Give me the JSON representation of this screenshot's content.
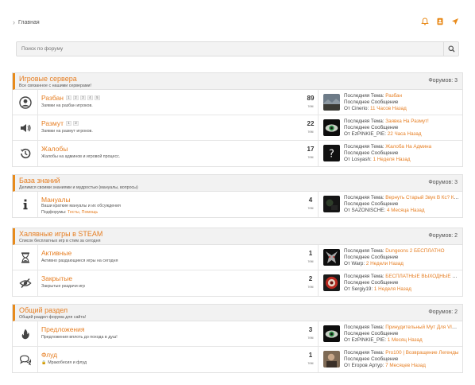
{
  "breadcrumb": {
    "home": "Главная"
  },
  "search": {
    "placeholder": "Поиск по форуму"
  },
  "sections": [
    {
      "title": "Игровые сервера",
      "desc": "Все связанное с нашими серверами!",
      "count": "Форумов: 3",
      "forums": [
        {
          "icon": "user-icon",
          "name": "Разбан",
          "pages": [
            "1",
            "2",
            "3",
            "4",
            "5"
          ],
          "desc": "Заявки на разбан игроков.",
          "sub": "",
          "sub_links": "",
          "threads": "89",
          "threads_label": "тем",
          "last_topic_label": "Последняя Тема:",
          "last_topic": "Разбан",
          "last_msg": "Последнее Сообщение",
          "from_label": "От",
          "author": "Cinerio:",
          "time": "11 Часов Назад",
          "avatar": "landscape"
        },
        {
          "icon": "volume-icon",
          "name": "Размут",
          "pages": [
            "1",
            "2"
          ],
          "desc": "Заявки на размут игроков.",
          "sub": "",
          "sub_links": "",
          "threads": "22",
          "threads_label": "тем",
          "last_topic_label": "Последняя Тема:",
          "last_topic": "Заявка На Размут!",
          "last_msg": "Последнее Сообщение",
          "from_label": "От",
          "author": "EzPINKIE_PIE:",
          "time": "22 Часа Назад",
          "avatar": "eye"
        },
        {
          "icon": "history-icon",
          "name": "Жалобы",
          "pages": [],
          "desc": "Жалобы на админов и игровой процесс.",
          "sub": "",
          "sub_links": "",
          "threads": "17",
          "threads_label": "тем",
          "last_topic_label": "Последняя Тема:",
          "last_topic": "Жалоба На Админа",
          "last_msg": "Последнее Сообщение",
          "from_label": "От",
          "author": "Losyash:",
          "time": "1 Неделя Назад",
          "avatar": "question"
        }
      ]
    },
    {
      "title": "База знаний",
      "desc": "Делимся своими знаниями и мудростью (мануалы, вопросы)",
      "count": "Форумов: 3",
      "forums": [
        {
          "icon": "info-icon",
          "name": "Мануалы",
          "pages": [],
          "desc": "Ваши краткие мануалы и их обсуждения",
          "sub": "Подфорумы:",
          "sub_links": "Тесты, Помощь",
          "threads": "4",
          "threads_label": "тем",
          "last_topic_label": "Последняя Тема:",
          "last_topic": "Вернуть Старый Звук В Кс? Как Отключить Новы...",
          "last_msg": "Последнее Сообщение",
          "from_label": "От",
          "author": "SAZONISCHE:",
          "time": "4 Месяца Назад",
          "avatar": "dark"
        }
      ]
    },
    {
      "title": "Халявные игры в STEAM",
      "desc": "Список бесплатных игр в стим за сегодня",
      "count": "Форумов: 2",
      "forums": [
        {
          "icon": "hourglass-icon",
          "name": "Активные",
          "pages": [],
          "desc": "Активно раздающиеся игры на сегодня",
          "sub": "",
          "sub_links": "",
          "threads": "1",
          "threads_label": "тем",
          "last_topic_label": "Последняя Тема:",
          "last_topic": "Dungeons 2 БЕСПЛАТНО",
          "last_msg": "Последнее Сообщение",
          "from_label": "От",
          "author": "Warp:",
          "time": "2 Недели Назад",
          "avatar": "demon"
        },
        {
          "icon": "eye-slash-icon",
          "name": "Закрытые",
          "pages": [],
          "desc": "Закрытые раздачи игр",
          "sub": "",
          "sub_links": "",
          "threads": "2",
          "threads_label": "тем",
          "last_topic_label": "Последняя Тема:",
          "last_topic": "БЕСПЛАТНЫЕ ВЫХОДНЫЕ С ГРУППОЙ...",
          "last_msg": "Последнее Сообщение",
          "from_label": "От",
          "author": "Sergiy19:",
          "time": "1 Неделя Назад",
          "avatar": "red"
        }
      ]
    },
    {
      "title": "Общий раздел",
      "desc": "Общий раздел форума для сайта!",
      "count": "Форумов: 2",
      "forums": [
        {
          "icon": "flame-icon",
          "name": "Предложения",
          "pages": [],
          "desc": "Предложения вплоть до похода в душ!",
          "sub": "",
          "sub_links": "",
          "threads": "3",
          "threads_label": "тем",
          "last_topic_label": "Последняя Тема:",
          "last_topic": "Принудительный Мут Для VIP И Обычных Игроков",
          "last_msg": "Последнее Сообщение",
          "from_label": "От",
          "author": "EzPINKIE_PIE:",
          "time": "1 Месяц Назад",
          "avatar": "eye"
        },
        {
          "icon": "chat-icon",
          "name": "Флуд",
          "pages": [],
          "desc": "Мракобесия и флуд",
          "sub": "",
          "sub_links": "",
          "threads": "1",
          "threads_label": "тем",
          "locked": true,
          "last_topic_label": "Последняя Тема:",
          "last_topic": "Pro100 | Возвращение Легенды",
          "last_msg": "Последнее Сообщение",
          "from_label": "От",
          "author": "Егоров Артур:",
          "time": "7 Месяцев Назад",
          "avatar": "photo"
        }
      ]
    }
  ]
}
